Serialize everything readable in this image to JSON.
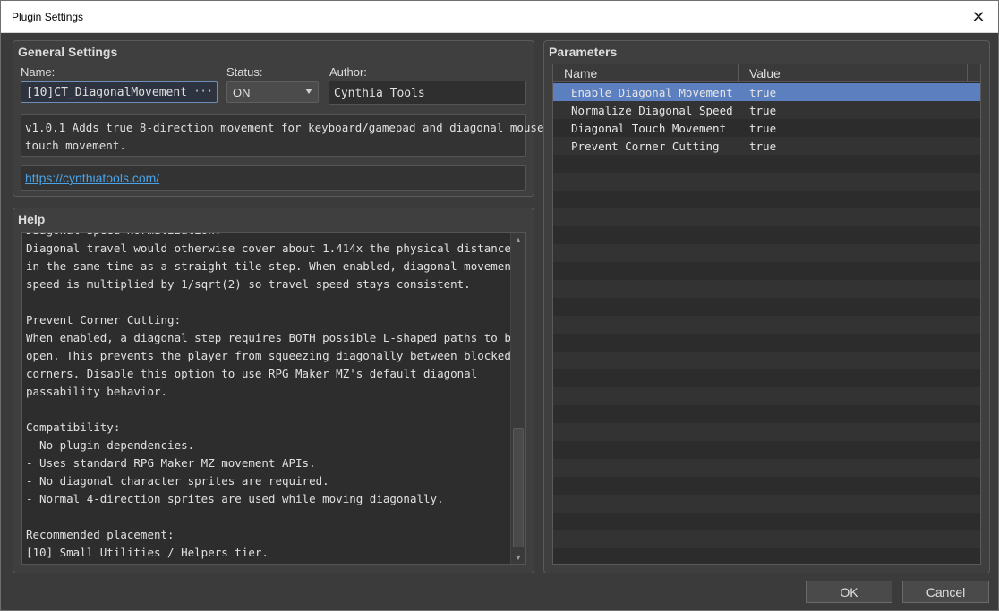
{
  "window": {
    "title": "Plugin Settings",
    "close_glyph": "✕"
  },
  "general": {
    "heading": "General Settings",
    "name_label": "Name:",
    "name_value": "[10]CT_DiagonalMovement",
    "name_button": "···",
    "status_label": "Status:",
    "status_value": "ON",
    "author_label": "Author:",
    "author_value": "Cynthia Tools",
    "description": "v1.0.1 Adds true 8-direction movement for keyboard/gamepad and diagonal mouse/\ntouch movement.",
    "url": "https://cynthiatools.com/"
  },
  "help": {
    "heading": "Help",
    "text": "Diagonal Speed Normalization:\nDiagonal travel would otherwise cover about 1.414x the physical distance\nin the same time as a straight tile step. When enabled, diagonal movement\nspeed is multiplied by 1/sqrt(2) so travel speed stays consistent.\n\nPrevent Corner Cutting:\nWhen enabled, a diagonal step requires BOTH possible L-shaped paths to be\nopen. This prevents the player from squeezing diagonally between blocked\ncorners. Disable this option to use RPG Maker MZ's default diagonal\npassability behavior.\n\nCompatibility:\n- No plugin dependencies.\n- Uses standard RPG Maker MZ movement APIs.\n- No diagonal character sprites are required.\n- Normal 4-direction sprites are used while moving diagonally.\n\nRecommended placement:\n[10] Small Utilities / Helpers tier."
  },
  "parameters": {
    "heading": "Parameters",
    "col_name": "Name",
    "col_value": "Value",
    "rows": [
      {
        "name": "Enable Diagonal Movement",
        "value": "true"
      },
      {
        "name": "Normalize Diagonal Speed",
        "value": "true"
      },
      {
        "name": "Diagonal Touch Movement",
        "value": "true"
      },
      {
        "name": "Prevent Corner Cutting",
        "value": "true"
      }
    ],
    "selected_index": 0
  },
  "buttons": {
    "ok": "OK",
    "cancel": "Cancel"
  }
}
